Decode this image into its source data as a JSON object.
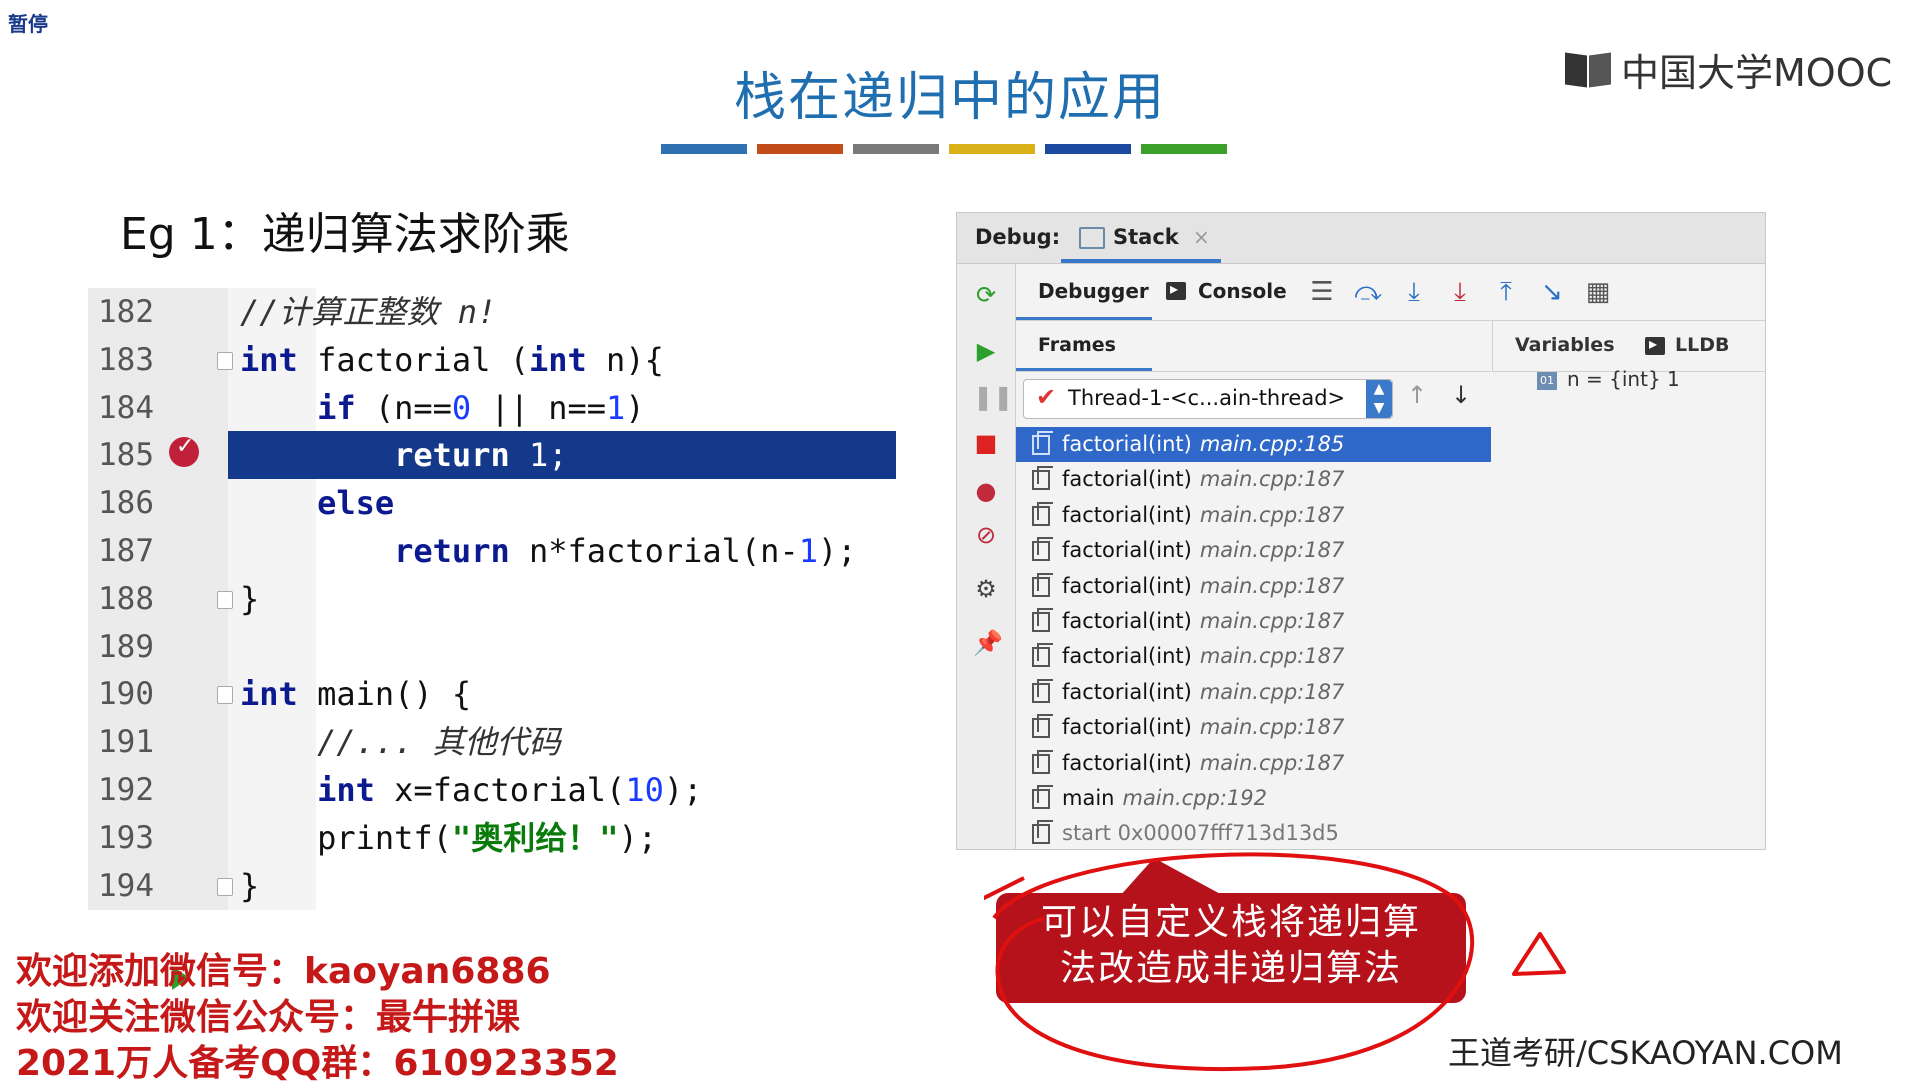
{
  "overlay": {
    "pause_label": "暂停"
  },
  "slide": {
    "title": "栈在递归中的应用",
    "color_bar": [
      "#2e72b4",
      "#c34d1a",
      "#7a7a7a",
      "#d9b21a",
      "#1c4aa0",
      "#3aa02a"
    ],
    "example_heading": "Eg 1：递归算法求阶乘"
  },
  "logo": {
    "text": "中国大学MOOC"
  },
  "code": {
    "lines": [
      {
        "no": "182",
        "text": "//计算正整数 n!"
      },
      {
        "no": "183",
        "text": "int factorial (int n){"
      },
      {
        "no": "184",
        "text": "    if (n==0 || n==1)"
      },
      {
        "no": "185",
        "text": "        return 1;"
      },
      {
        "no": "186",
        "text": "    else"
      },
      {
        "no": "187",
        "text": "        return n*factorial(n-1);"
      },
      {
        "no": "188",
        "text": "}"
      },
      {
        "no": "189",
        "text": ""
      },
      {
        "no": "190",
        "text": "int main() {"
      },
      {
        "no": "191",
        "text": "    //... 其他代码"
      },
      {
        "no": "192",
        "text": "    int x=factorial(10);"
      },
      {
        "no": "193",
        "text": "    printf(\"奥利给！\");"
      },
      {
        "no": "194",
        "text": "}"
      }
    ],
    "current_line": "185"
  },
  "debug": {
    "label": "Debug:",
    "stack_tab": "Stack",
    "tabs": {
      "debugger": "Debugger",
      "console": "Console"
    },
    "frames_tab": "Frames",
    "variables_tab": "Variables",
    "lldb_tab": "LLDB",
    "thread": "Thread-1-<c...ain-thread>",
    "frames": [
      {
        "fn": "factorial(int)",
        "loc": "main.cpp:185",
        "selected": true
      },
      {
        "fn": "factorial(int)",
        "loc": "main.cpp:187"
      },
      {
        "fn": "factorial(int)",
        "loc": "main.cpp:187"
      },
      {
        "fn": "factorial(int)",
        "loc": "main.cpp:187"
      },
      {
        "fn": "factorial(int)",
        "loc": "main.cpp:187"
      },
      {
        "fn": "factorial(int)",
        "loc": "main.cpp:187"
      },
      {
        "fn": "factorial(int)",
        "loc": "main.cpp:187"
      },
      {
        "fn": "factorial(int)",
        "loc": "main.cpp:187"
      },
      {
        "fn": "factorial(int)",
        "loc": "main.cpp:187"
      },
      {
        "fn": "factorial(int)",
        "loc": "main.cpp:187"
      },
      {
        "fn": "main",
        "loc": "main.cpp:192"
      },
      {
        "fn": "start 0x00007fff713d13d5",
        "loc": "",
        "dim": true
      }
    ],
    "variable": {
      "badge": "01",
      "text": "n = {int} 1"
    }
  },
  "callout": {
    "line1": "可以自定义栈将递归算",
    "line2": "法改造成非递归算法"
  },
  "footer": {
    "promo_1": "欢迎添加微信号：kaoyan6886",
    "promo_2": "欢迎关注微信公众号：最牛拼课",
    "promo_3": "2021万人备考QQ群：610923352",
    "brand": "王道考研/CSKAOYAN.COM"
  }
}
